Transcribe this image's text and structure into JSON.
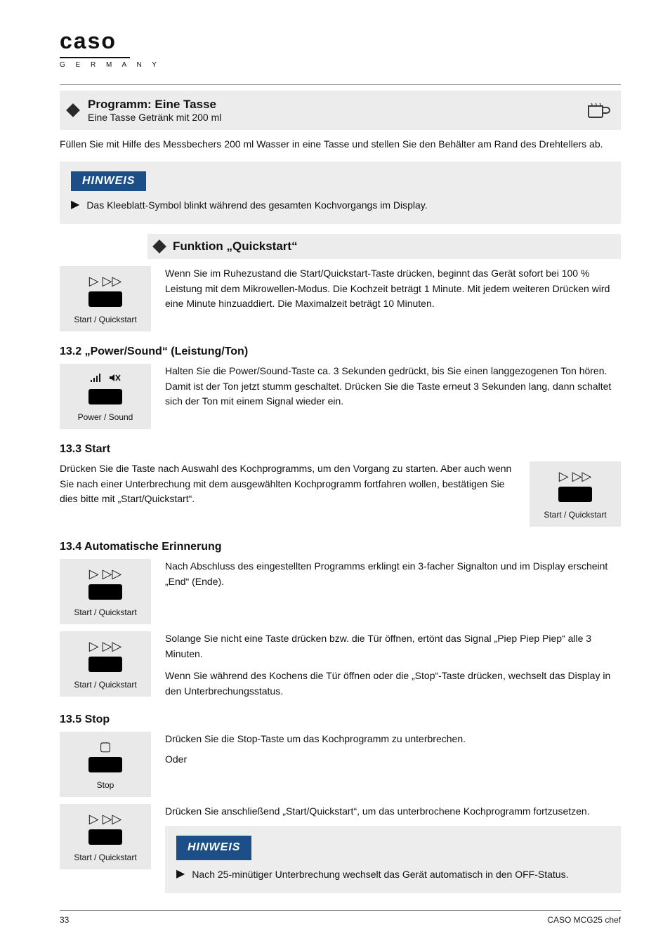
{
  "logo": {
    "main": "caso",
    "sub": "G E R M A N Y"
  },
  "band1": {
    "title": "Programm: Eine Tasse",
    "subtitle": "Eine Tasse Getränk mit 200 ml"
  },
  "intro": "Füllen Sie mit Hilfe des Messbechers 200 ml Wasser in eine Tasse und stellen Sie den Behälter am Rand des Drehtellers ab.",
  "note1": "Das Kleeblatt-Symbol blinkt während des gesamten Kochvorgangs im Display.",
  "band2": {
    "title": "Funktion „Quickstart“ "
  },
  "quickstart_text": "Wenn Sie im Ruhezustand die Start/Quickstart-Taste drücken, beginnt das Gerät sofort bei 100 % Leistung mit dem Mikrowellen-Modus. Die Kochzeit beträgt 1 Minute. Mit jedem weiteren Drücken wird eine Minute hinzuaddiert. Die Maximalzeit beträgt 10 Minuten.",
  "power_sound_heading": "13.2 „Power/Sound“ (Leistung/Ton)",
  "power_sound_text": "Halten Sie die Power/Sound-Taste ca. 3 Sekunden gedrückt, bis Sie einen langgezogenen Ton hören. Damit ist der Ton jetzt stumm geschaltet. Drücken Sie die Taste erneut 3 Sekunden lang, dann schaltet sich der Ton mit einem Signal wieder ein.",
  "start_heading": "13.3 Start",
  "start_text": "Drücken Sie die Taste nach Auswahl des Kochprogramms, um den Vorgang zu starten. Aber auch wenn Sie nach einer Unterbrechung mit dem ausgewählten Kochprogramm fortfahren wollen, bestätigen Sie dies bitte mit „Start/Quickstart“.",
  "auto_heading": "13.4 Automatische Erinnerung",
  "auto_p1": "Nach Abschluss des eingestellten Programms erklingt ein 3-facher Signalton und im Display erscheint „End“ (Ende).",
  "auto_p2": "Solange Sie nicht eine Taste drücken bzw. die Tür öffnen, ertönt das Signal „Piep Piep Piep“ alle 3 Minuten.",
  "auto_p3": "Wenn Sie während des Kochens die Tür öffnen oder die „Stop“-Taste drücken, wechselt das Display in den Unterbrechungsstatus.",
  "stop_heading": "13.5 Stop",
  "stop_text": "Drücken Sie die Stop-Taste um das Kochprogramm zu unterbrechen.",
  "or_label": "Oder",
  "resume_text": "Drücken Sie anschließend „Start/Quickstart“, um das unterbrochene Kochprogramm fortzusetzen.",
  "note2": "Nach 25-minütiger Unterbrechung wechselt das Gerät automatisch in den OFF-Status.",
  "key": {
    "start_quickstart": "Start / Quickstart",
    "power_sound": "Power / Sound",
    "stop": "Stop"
  },
  "footer": {
    "page": "33",
    "title": "CASO MCG25 chef"
  }
}
